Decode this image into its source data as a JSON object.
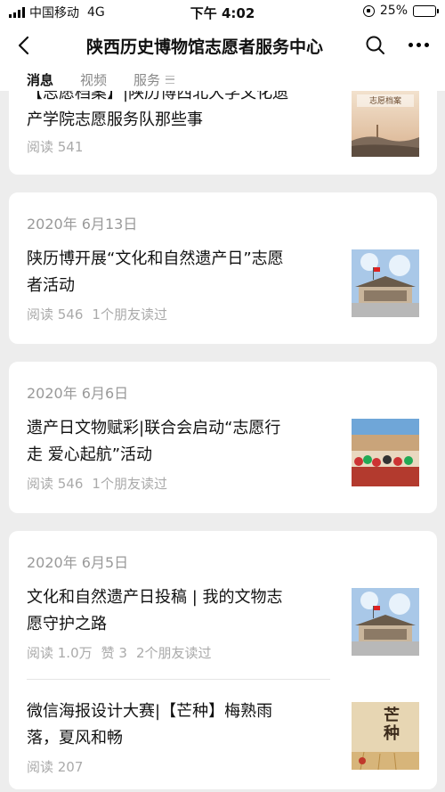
{
  "status_bar": {
    "carrier": "中国移动",
    "network": "4G",
    "time": "下午 4:02",
    "battery_percent": "25%",
    "battery_level": 0.25
  },
  "nav": {
    "title": "陕西历史博物馆志愿者服务中心",
    "back_icon": "back-chevron-icon",
    "search_icon": "search-icon",
    "more_icon": "more-icon"
  },
  "tabs": [
    {
      "label": "消息",
      "active": true
    },
    {
      "label": "视频",
      "active": false
    },
    {
      "label": "服务",
      "active": false
    }
  ],
  "cards": [
    {
      "date": "",
      "articles": [
        {
          "title": "【志愿档案】|陕历博西北大学文化遗产学院志愿服务队那些事",
          "title_visible_line1": "【志愿档案】|陕历博西北大学文化遗",
          "title_visible_line2": "产学院志愿服务队那些事",
          "reads": "阅读 541",
          "likes": "",
          "friends": "",
          "thumb": "book-cover",
          "thumb_caption": "志愿档案"
        }
      ]
    },
    {
      "date": "2020年 6月13日",
      "articles": [
        {
          "title_visible_line1": "陕历博开展“文化和自然遗产日”志愿",
          "title_visible_line2": "者活动",
          "reads": "阅读 546",
          "likes": "",
          "friends": "1个朋友读过",
          "thumb": "museum-photo"
        }
      ]
    },
    {
      "date": "2020年 6月6日",
      "articles": [
        {
          "title_visible_line1": "遗产日文物赋彩|联合会启动“志愿行",
          "title_visible_line2": "走 爱心起航”活动",
          "reads": "阅读 546",
          "likes": "",
          "friends": "1个朋友读过",
          "thumb": "crowd-photo"
        }
      ]
    },
    {
      "date": "2020年 6月5日",
      "articles": [
        {
          "title_visible_line1": "文化和自然遗产日投稿 | 我的文物志",
          "title_visible_line2": "愿守护之路",
          "reads": "阅读 1.0万",
          "likes": "赞 3",
          "friends": "2个朋友读过",
          "thumb": "museum-photo"
        },
        {
          "title_visible_line1": "微信海报设计大赛|【芒种】梅熟雨",
          "title_visible_line2": "落，夏风和畅",
          "reads": "阅读 207",
          "likes": "",
          "friends": "",
          "thumb": "poster",
          "thumb_caption": "芒种"
        }
      ]
    }
  ]
}
